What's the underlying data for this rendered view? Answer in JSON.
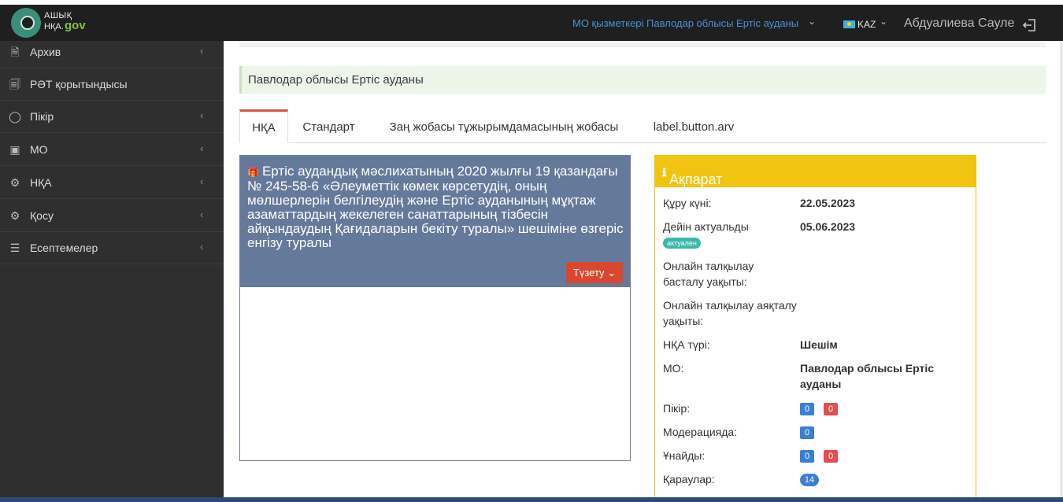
{
  "header": {
    "logo_line1": "АШЫҚ",
    "logo_line2": "НҚА.",
    "logo_gov": "gov",
    "org_selector": "МО қызметкері Павлодар облысы Ертіс ауданы",
    "language": "KAZ",
    "user_name": "Абдуалиева Сауле",
    "icons": {
      "org_chevron": "chevron-down-icon",
      "lang_chevron": "chevron-down-icon",
      "flag": "kz-flag-icon",
      "logout": "logout-icon"
    }
  },
  "sidebar": {
    "items": [
      {
        "label": "Архив",
        "icon": "archive-icon",
        "has_chevron": true
      },
      {
        "label": "РӘТ қорытындысы",
        "icon": "document-icon",
        "has_chevron": false
      },
      {
        "label": "Пікір",
        "icon": "comment-icon",
        "has_chevron": true
      },
      {
        "label": "МО",
        "icon": "briefcase-icon",
        "has_chevron": true
      },
      {
        "label": "НҚА",
        "icon": "gear-icon",
        "has_chevron": true
      },
      {
        "label": "Қосу",
        "icon": "gear-icon",
        "has_chevron": true
      },
      {
        "label": "Есептемелер",
        "icon": "list-icon",
        "has_chevron": true
      }
    ]
  },
  "breadcrumb": "Павлодар облысы Ертіс ауданы",
  "tabs": [
    {
      "label": "НҚА",
      "active": true
    },
    {
      "label": "Стандарт",
      "active": false
    },
    {
      "label": "Заң жобасы тұжырымдамасының жобасы",
      "active": false
    },
    {
      "label": "label.button.arv",
      "active": false
    }
  ],
  "document": {
    "title": "Ертіс аудандық мәслихатының 2020 жылғы 19 қазандағы № 245-58-6 «Әлеуметтік көмек көрсетудің, оның мөлшерлерін белгілеудің және Ертіс ауданының мұқтаж азаматтардың жекелеген санаттарының тізбесін айқындаудың Қағидаларын бекіту туралы» шешіміне өзгеріс енгізу туралы",
    "edit_button": "Түзету"
  },
  "info": {
    "title": "Ақпарат",
    "created_label": "Құру күні:",
    "created_value": "22.05.2023",
    "actual_label": "Дейін актуальды",
    "actual_value": "05.06.2023",
    "actual_status": "актуален",
    "discussion_start_label": "Онлайн талқылау басталу уақыты:",
    "discussion_end_label": "Онлайн талқылау аяқталу уақыты:",
    "type_label": "НҚА түрі:",
    "type_value": "Шешім",
    "mo_label": "МО:",
    "mo_value": "Павлодар облысы Ертіс ауданы",
    "comments_label": "Пікір:",
    "comments_blue": "0",
    "comments_red": "0",
    "moderation_label": "Модерацияда:",
    "moderation_value": "0",
    "likes_label": "Ұнайды:",
    "likes_blue": "0",
    "likes_red": "0",
    "views_label": "Қараулар:",
    "views_value": "14"
  },
  "colors": {
    "sidebar_bg": "#2f2f2f",
    "header_bg": "#1f1f1f",
    "doc_header": "#65799b",
    "info_header": "#f2c30f",
    "accent_red": "#d9472f",
    "badge_blue": "#3a7fd5",
    "badge_red": "#e44d4d",
    "status_teal": "#3bb8a8"
  }
}
